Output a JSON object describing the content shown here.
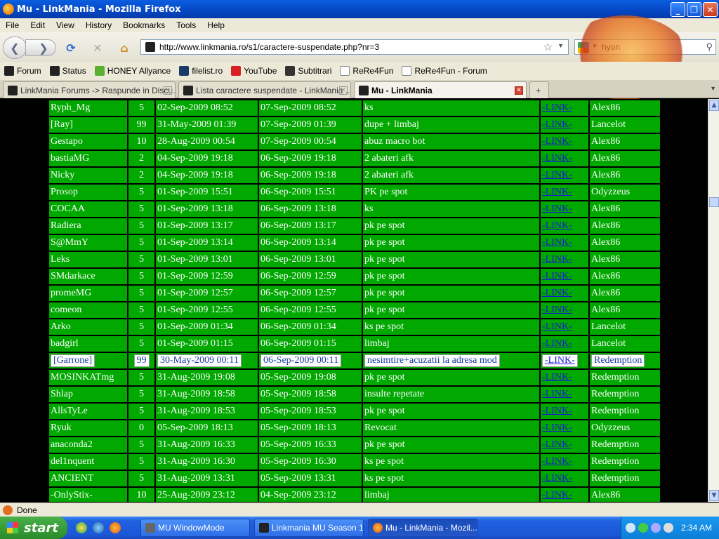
{
  "window": {
    "title": "Mu - LinkMania - Mozilla Firefox"
  },
  "menu": [
    "File",
    "Edit",
    "View",
    "History",
    "Bookmarks",
    "Tools",
    "Help"
  ],
  "nav": {
    "url": "http://www.linkmania.ro/s1/caractere-suspendate.php?nr=3",
    "search": "hyon"
  },
  "bookmarks": [
    "Forum",
    "Status",
    "HONEY Allyance",
    "filelist.ro",
    "YouTube",
    "Subtitrari",
    "ReRe4Fun",
    "ReRe4Fun - Forum"
  ],
  "tabs": [
    {
      "label": "LinkMania Forums -> Raspunde in Discu..."
    },
    {
      "label": "Lista caractere suspendate - LinkMania ..."
    },
    {
      "label": "Mu - LinkMania"
    }
  ],
  "table": {
    "link_label": "-LINK-",
    "rows": [
      [
        "Ryph_Mg",
        "5",
        "02-Sep-2009 08:52",
        "07-Sep-2009 08:52",
        "ks",
        "Alex86"
      ],
      [
        "[Ray]",
        "99",
        "31-May-2009 01:39",
        "07-Sep-2009 01:39",
        "dupe + limbaj",
        "Lancelot"
      ],
      [
        "Gestapo",
        "10",
        "28-Aug-2009 00:54",
        "07-Sep-2009 00:54",
        "abuz macro bot",
        "Alex86"
      ],
      [
        "bastiaMG",
        "2",
        "04-Sep-2009 19:18",
        "06-Sep-2009 19:18",
        "2 abateri afk",
        "Alex86"
      ],
      [
        "Nicky",
        "2",
        "04-Sep-2009 19:18",
        "06-Sep-2009 19:18",
        "2 abateri afk",
        "Alex86"
      ],
      [
        "Prosop",
        "5",
        "01-Sep-2009 15:51",
        "06-Sep-2009 15:51",
        "PK pe spot",
        "Odyzzeus"
      ],
      [
        "COCAA",
        "5",
        "01-Sep-2009 13:18",
        "06-Sep-2009 13:18",
        "ks",
        "Alex86"
      ],
      [
        "Radiera",
        "5",
        "01-Sep-2009 13:17",
        "06-Sep-2009 13:17",
        "pk pe spot",
        "Alex86"
      ],
      [
        "S@MmY",
        "5",
        "01-Sep-2009 13:14",
        "06-Sep-2009 13:14",
        "pk pe spot",
        "Alex86"
      ],
      [
        "Leks",
        "5",
        "01-Sep-2009 13:01",
        "06-Sep-2009 13:01",
        "pk pe spot",
        "Alex86"
      ],
      [
        "SMdarkace",
        "5",
        "01-Sep-2009 12:59",
        "06-Sep-2009 12:59",
        "pk pe spot",
        "Alex86"
      ],
      [
        "promeMG",
        "5",
        "01-Sep-2009 12:57",
        "06-Sep-2009 12:57",
        "pk pe spot",
        "Alex86"
      ],
      [
        "comeon",
        "5",
        "01-Sep-2009 12:55",
        "06-Sep-2009 12:55",
        "pk pe spot",
        "Alex86"
      ],
      [
        "Arko",
        "5",
        "01-Sep-2009 01:34",
        "06-Sep-2009 01:34",
        "ks pe spot",
        "Lancelot"
      ],
      [
        "badgirl",
        "5",
        "01-Sep-2009 01:15",
        "06-Sep-2009 01:15",
        "limbaj",
        "Lancelot"
      ],
      [
        "[Garrone]",
        "99",
        "30-May-2009 00:11",
        "06-Sep-2009 00:11",
        "nesimtire+acuzatii la adresa mod",
        "Redemption"
      ],
      [
        "MOSINKATmg",
        "5",
        "31-Aug-2009 19:08",
        "05-Sep-2009 19:08",
        "pk pe spot",
        "Redemption"
      ],
      [
        "Shlap",
        "5",
        "31-Aug-2009 18:58",
        "05-Sep-2009 18:58",
        "insulte repetate",
        "Redemption"
      ],
      [
        "AllsTyLe",
        "5",
        "31-Aug-2009 18:53",
        "05-Sep-2009 18:53",
        "pk pe spot",
        "Redemption"
      ],
      [
        "Ryuk",
        "0",
        "05-Sep-2009 18:13",
        "05-Sep-2009 18:13",
        "Revocat",
        "Odyzzeus"
      ],
      [
        "anaconda2",
        "5",
        "31-Aug-2009 16:33",
        "05-Sep-2009 16:33",
        "pk pe spot",
        "Redemption"
      ],
      [
        "del1nquent",
        "5",
        "31-Aug-2009 16:30",
        "05-Sep-2009 16:30",
        "ks pe spot",
        "Redemption"
      ],
      [
        "ANCIENT",
        "5",
        "31-Aug-2009 13:31",
        "05-Sep-2009 13:31",
        "ks pe spot",
        "Redemption"
      ],
      [
        "-OnlyStix-",
        "10",
        "25-Aug-2009 23:12",
        "04-Sep-2009 23:12",
        "limbaj",
        "Alex86"
      ]
    ]
  },
  "status": "Done",
  "taskbar": {
    "start": "start",
    "tasks": [
      "MU WindowMode",
      "Linkmania MU Season 1",
      "Mu - LinkMania - Mozil..."
    ],
    "clock": "2:34 AM"
  }
}
